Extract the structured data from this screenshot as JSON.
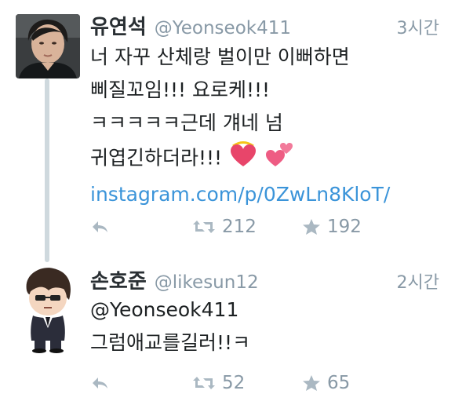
{
  "tweets": [
    {
      "name": "유연석",
      "handle": "@Yeonseok411",
      "time": "3시간",
      "lines": [
        "너 자꾸 산체랑 벌이만 이뻐하면",
        "삐질꼬임!!! 요로케!!!",
        "ㅋㅋㅋㅋㅋ근데 걔네 넘",
        "귀엽긴하더라!!!"
      ],
      "link": "instagram.com/p/0ZwLn8KloT/",
      "retweets": "212",
      "favorites": "192",
      "icons": {
        "reply": "reply-icon",
        "retweet": "retweet-icon",
        "favorite": "star-icon"
      }
    },
    {
      "name": "손호준",
      "handle": "@likesun12",
      "time": "2시간",
      "lines": [
        "@Yeonseok411",
        "그럼애교를길러!!ㅋ"
      ],
      "retweets": "52",
      "favorites": "65",
      "icons": {
        "reply": "reply-icon",
        "retweet": "retweet-icon",
        "favorite": "star-icon"
      }
    }
  ],
  "colors": {
    "link": "#3b94d9",
    "meta": "#8899a6",
    "thread_line": "#cfd9de",
    "text": "#1c2022"
  }
}
